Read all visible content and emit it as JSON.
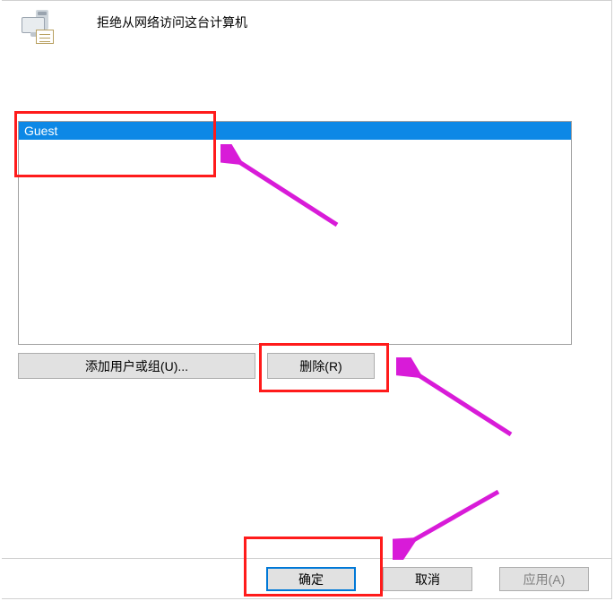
{
  "header": {
    "title": "拒绝从网络访问这台计算机"
  },
  "list": {
    "items": [
      {
        "label": "Guest",
        "selected": true
      }
    ]
  },
  "actions": {
    "add_label": "添加用户或组(U)...",
    "remove_label": "删除(R)"
  },
  "dialog": {
    "ok_label": "确定",
    "cancel_label": "取消",
    "apply_label": "应用(A)"
  }
}
